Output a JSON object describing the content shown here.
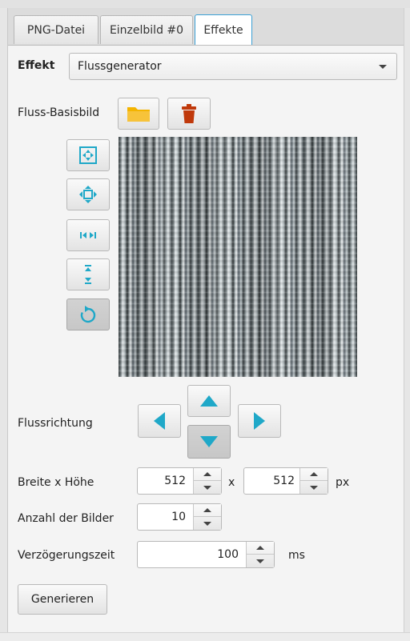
{
  "tabs": [
    {
      "label": "PNG-Datei"
    },
    {
      "label": "Einzelbild #0"
    },
    {
      "label": "Effekte"
    }
  ],
  "effect": {
    "label": "Effekt",
    "selected": "Flussgenerator"
  },
  "base_image": {
    "label": "Fluss-Basisbild",
    "open_icon": "folder-icon",
    "delete_icon": "trash-icon"
  },
  "preview_tools": [
    {
      "icon": "fit-both-icon"
    },
    {
      "icon": "move-icon"
    },
    {
      "icon": "fit-width-icon"
    },
    {
      "icon": "fit-height-icon"
    },
    {
      "icon": "rotate-icon",
      "pressed": true
    }
  ],
  "direction": {
    "label": "Flussrichtung",
    "selected": "down"
  },
  "size": {
    "label": "Breite x Höhe",
    "width": "512",
    "separator": "x",
    "height": "512",
    "unit": "px"
  },
  "frames": {
    "label": "Anzahl der Bilder",
    "value": "10"
  },
  "delay": {
    "label": "Verzögerungszeit",
    "value": "100",
    "unit": "ms"
  },
  "generate_label": "Generieren",
  "colors": {
    "accent": "#1fa8c8",
    "tab_active_border": "#3aa0d5",
    "folder": "#f4b400",
    "trash": "#c0390b"
  }
}
